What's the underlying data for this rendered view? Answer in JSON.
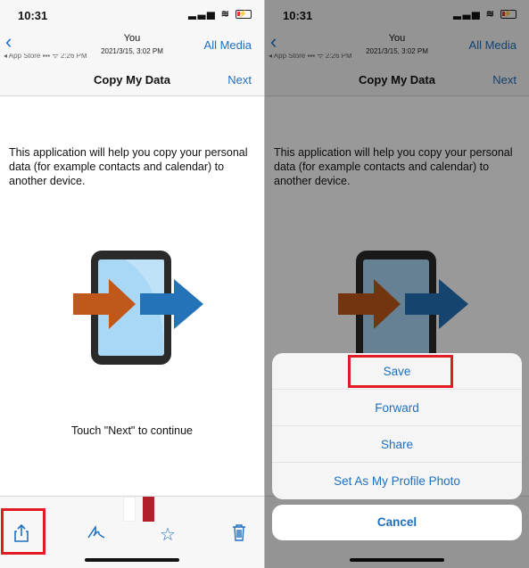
{
  "status": {
    "time": "10:31",
    "icons": "signal wifi battery-charging"
  },
  "header": {
    "back": "‹",
    "sender": "You",
    "date": "2021/3/15, 3:02 PM",
    "all_media": "All Media"
  },
  "ghost_status": "◂ App Store ▪▪▪ ᯤ        2:26 PM",
  "navbar": {
    "title": "Copy My Data",
    "next": "Next"
  },
  "content": {
    "intro": "This application will help you copy your personal data (for example contacts and calendar) to another device.",
    "touch": "Touch \"Next\" to continue"
  },
  "toolbar": {
    "share": "share-icon",
    "markup": "markup-icon",
    "favorite": "star-icon",
    "delete": "trash-icon"
  },
  "action_sheet": {
    "options": [
      "Save",
      "Forward",
      "Share",
      "Set As My Profile Photo"
    ],
    "cancel": "Cancel"
  },
  "colors": {
    "accent": "#1f6fbf",
    "highlight": "#e01b24",
    "arrow_orange": "#c0581c",
    "arrow_blue": "#2472b8"
  }
}
